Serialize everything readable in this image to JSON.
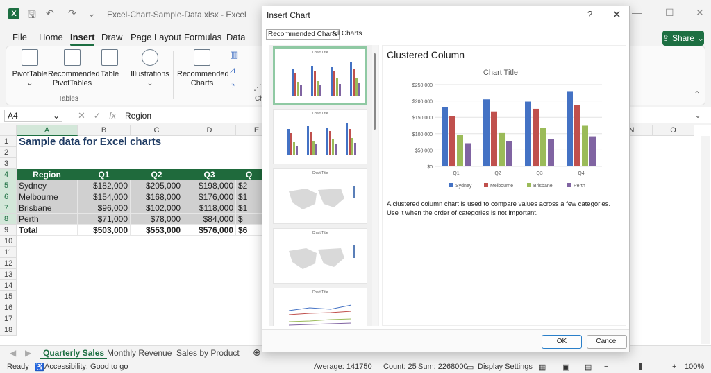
{
  "window": {
    "title": "Excel-Chart-Sample-Data.xlsx - Excel"
  },
  "ribbon_tabs": [
    "File",
    "Home",
    "Insert",
    "Draw",
    "Page Layout",
    "Formulas",
    "Data"
  ],
  "share_label": "Share",
  "ribbon": {
    "pivottable": "PivotTable",
    "recommended_pivot": [
      "Recommended",
      "PivotTables"
    ],
    "table": "Table",
    "tables_group": "Tables",
    "illustrations": "Illustrations",
    "recommended_charts": [
      "Recommended",
      "Charts"
    ],
    "charts_group_partial": "Ch"
  },
  "formula_bar": {
    "cell_ref": "A4",
    "value": "Region",
    "fx": "fx"
  },
  "columns": [
    "A",
    "B",
    "C",
    "D",
    "E",
    "N",
    "O"
  ],
  "rows": [
    "1",
    "2",
    "3",
    "4",
    "5",
    "6",
    "7",
    "8",
    "9",
    "10",
    "11",
    "12",
    "13",
    "14",
    "15",
    "16",
    "17",
    "18"
  ],
  "sheet": {
    "title": "Sample data for Excel charts",
    "headers": [
      "Region",
      "Q1",
      "Q2",
      "Q3",
      "Q"
    ],
    "data": [
      [
        "Sydney",
        "$182,000",
        "$205,000",
        "$198,000",
        "$2"
      ],
      [
        "Melbourne",
        "$154,000",
        "$168,000",
        "$176,000",
        "$1"
      ],
      [
        "Brisbane",
        "$96,000",
        "$102,000",
        "$118,000",
        "$1"
      ],
      [
        "Perth",
        "$71,000",
        "$78,000",
        "$84,000",
        "$"
      ]
    ],
    "total": [
      "Total",
      "$503,000",
      "$553,000",
      "$576,000",
      "$6"
    ]
  },
  "sheet_tabs": [
    "Quarterly Sales",
    "Monthly Revenue",
    "Sales by Product"
  ],
  "status": {
    "ready": "Ready",
    "accessibility": "Accessibility: Good to go",
    "average": "Average: 141750",
    "count": "Count: 25",
    "sum": "Sum: 2268000",
    "display": "Display Settings",
    "zoom": "100%"
  },
  "dialog": {
    "title": "Insert Chart",
    "help": "?",
    "tabs": [
      "Recommended Charts",
      "All Charts"
    ],
    "chart_name": "Clustered Column",
    "description": "A clustered column chart is used to compare values across a few categories. Use it when the order of categories is not important.",
    "ok": "OK",
    "cancel": "Cancel",
    "thumb_title": "Chart Title"
  },
  "colors": {
    "excel_green": "#1d6f42",
    "sydney": "#4472c4",
    "melbourne": "#c0504d",
    "brisbane": "#9bbb59",
    "perth": "#8064a2"
  },
  "chart_data": {
    "type": "bar",
    "title": "Chart Title",
    "categories": [
      "Q1",
      "Q2",
      "Q3",
      "Q4"
    ],
    "series": [
      {
        "name": "Sydney",
        "values": [
          182000,
          205000,
          198000,
          230000
        ]
      },
      {
        "name": "Melbourne",
        "values": [
          154000,
          168000,
          176000,
          188000
        ]
      },
      {
        "name": "Brisbane",
        "values": [
          96000,
          102000,
          118000,
          124000
        ]
      },
      {
        "name": "Perth",
        "values": [
          71000,
          78000,
          84000,
          92000
        ]
      }
    ],
    "ylim": [
      0,
      250000
    ],
    "yticks": [
      "$0",
      "$50,000",
      "$100,000",
      "$150,000",
      "$200,000",
      "$250,000"
    ],
    "grid": true,
    "legend": "bottom"
  }
}
